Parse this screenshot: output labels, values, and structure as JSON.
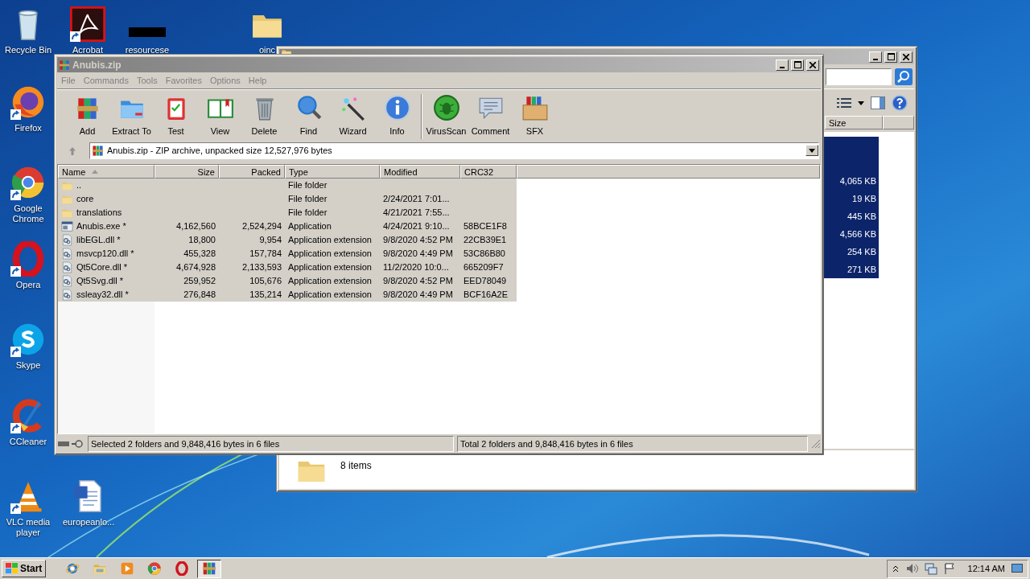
{
  "desktop_icons": [
    {
      "label": "Recycle Bin",
      "kind": "recycle",
      "shortcut": false
    },
    {
      "label": "Acrobat",
      "kind": "acrobat",
      "shortcut": true
    },
    {
      "label": "resourcese",
      "kind": "redacted",
      "shortcut": false
    },
    {
      "label": "oinc",
      "kind": "folder",
      "shortcut": false
    },
    {
      "label": "Firefox",
      "kind": "firefox",
      "shortcut": true
    },
    {
      "label": "Google Chrome",
      "kind": "chrome",
      "shortcut": true
    },
    {
      "label": "Opera",
      "kind": "opera",
      "shortcut": true
    },
    {
      "label": "Skype",
      "kind": "skype",
      "shortcut": true
    },
    {
      "label": "CCleaner",
      "kind": "ccleaner",
      "shortcut": true
    },
    {
      "label": "VLC media player",
      "kind": "vlc",
      "shortcut": true
    },
    {
      "label": "europeanlo...",
      "kind": "word",
      "shortcut": false
    }
  ],
  "explorer": {
    "columns": [
      "Size"
    ],
    "rows": [
      {
        "kind": "folder",
        "selected": true
      },
      {
        "kind": "folder",
        "selected": true
      },
      {
        "kind": "file",
        "size": "4,065 KB",
        "selected": true
      },
      {
        "kind": "file",
        "size": "19 KB",
        "selected": true
      },
      {
        "kind": "file",
        "size": "445 KB",
        "selected": true
      },
      {
        "kind": "file",
        "size": "4,566 KB",
        "selected": true
      },
      {
        "kind": "file",
        "size": "254 KB",
        "selected": true
      },
      {
        "kind": "file",
        "size": "271 KB",
        "selected": true
      }
    ],
    "status": "8 items"
  },
  "winrar": {
    "title": "Anubis.zip",
    "active": false,
    "menu": [
      "File",
      "Commands",
      "Tools",
      "Favorites",
      "Options",
      "Help"
    ],
    "toolbar_groups": [
      [
        {
          "label": "Add",
          "kind": "add"
        },
        {
          "label": "Extract To",
          "kind": "extract"
        },
        {
          "label": "Test",
          "kind": "test"
        },
        {
          "label": "View",
          "kind": "view"
        },
        {
          "label": "Delete",
          "kind": "delete"
        },
        {
          "label": "Find",
          "kind": "find"
        },
        {
          "label": "Wizard",
          "kind": "wizard"
        },
        {
          "label": "Info",
          "kind": "info"
        }
      ],
      [
        {
          "label": "VirusScan",
          "kind": "virusscan"
        },
        {
          "label": "Comment",
          "kind": "comment"
        },
        {
          "label": "SFX",
          "kind": "sfx"
        }
      ]
    ],
    "address": "Anubis.zip - ZIP archive, unpacked size 12,527,976 bytes",
    "columns": [
      {
        "label": "Name",
        "sorted": true
      },
      {
        "label": "Size",
        "sorted": false
      },
      {
        "label": "Packed",
        "sorted": false
      },
      {
        "label": "Type",
        "sorted": false
      },
      {
        "label": "Modified",
        "sorted": false
      },
      {
        "label": "CRC32",
        "sorted": false
      }
    ],
    "rows": [
      {
        "kind": "folder",
        "name": "..",
        "type": "File folder",
        "selected": true
      },
      {
        "kind": "folder",
        "name": "core",
        "type": "File folder",
        "modified": "2/24/2021 7:01...",
        "selected": true
      },
      {
        "kind": "folder",
        "name": "translations",
        "type": "File folder",
        "modified": "4/21/2021 7:55...",
        "selected": true
      },
      {
        "kind": "exe",
        "name": "Anubis.exe *",
        "size": "4,162,560",
        "packed": "2,524,294",
        "type": "Application",
        "modified": "4/24/2021 9:10...",
        "crc": "58BCE1F8",
        "selected": true
      },
      {
        "kind": "dll",
        "name": "libEGL.dll *",
        "size": "18,800",
        "packed": "9,954",
        "type": "Application extension",
        "modified": "9/8/2020 4:52 PM",
        "crc": "22CB39E1",
        "selected": true
      },
      {
        "kind": "dll",
        "name": "msvcp120.dll *",
        "size": "455,328",
        "packed": "157,784",
        "type": "Application extension",
        "modified": "9/8/2020 4:49 PM",
        "crc": "53C86B80",
        "selected": true
      },
      {
        "kind": "dll",
        "name": "Qt5Core.dll *",
        "size": "4,674,928",
        "packed": "2,133,593",
        "type": "Application extension",
        "modified": "11/2/2020 10:0...",
        "crc": "665209F7",
        "selected": true
      },
      {
        "kind": "dll",
        "name": "Qt5Svg.dll *",
        "size": "259,952",
        "packed": "105,676",
        "type": "Application extension",
        "modified": "9/8/2020 4:52 PM",
        "crc": "EED78049",
        "selected": true
      },
      {
        "kind": "dll",
        "name": "ssleay32.dll *",
        "size": "276,848",
        "packed": "135,214",
        "type": "Application extension",
        "modified": "9/8/2020 4:49 PM",
        "crc": "BCF16A2E",
        "selected": true
      }
    ],
    "status_left": "Selected 2 folders and 9,848,416 bytes in 6 files",
    "status_right": "Total 2 folders and 9,848,416 bytes in 6 files"
  },
  "taskbar": {
    "start": "Start",
    "apps": [
      {
        "kind": "ie",
        "selected": false
      },
      {
        "kind": "explorer",
        "selected": false
      },
      {
        "kind": "media",
        "selected": false
      },
      {
        "kind": "chrome",
        "selected": false
      },
      {
        "kind": "opera",
        "selected": false
      },
      {
        "kind": "winrar",
        "selected": true
      }
    ],
    "clock": "12:14 AM"
  }
}
